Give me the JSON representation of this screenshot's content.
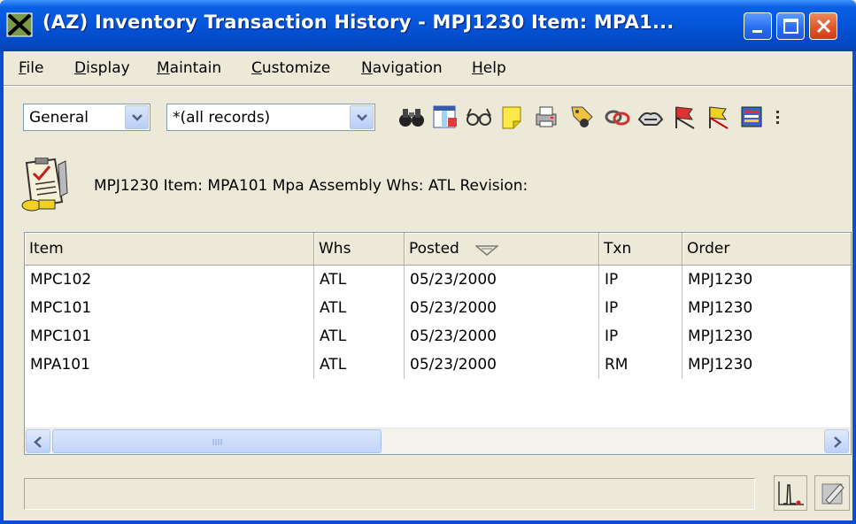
{
  "window": {
    "title": "(AZ) Inventory Transaction History - MPJ1230   Item: MPA1...",
    "app_icon": "job-x-icon",
    "controls": [
      "minimize-icon",
      "maximize-icon",
      "close-icon"
    ]
  },
  "menu": {
    "items": [
      {
        "label": "File"
      },
      {
        "label": "Display"
      },
      {
        "label": "Maintain"
      },
      {
        "label": "Customize"
      },
      {
        "label": "Navigation"
      },
      {
        "label": "Help"
      }
    ]
  },
  "toolbar": {
    "view_select": "General",
    "filter_select": "*(all records)",
    "tools": [
      "binoculars-icon",
      "column-chooser-icon",
      "glasses-icon",
      "note-icon",
      "printer-icon",
      "tag-icon",
      "link-icon",
      "handshake-icon",
      "flag-icon",
      "flag-alt-icon",
      "report-icon",
      "more-icon"
    ]
  },
  "header": {
    "icon": "clipboard-checklist-icon",
    "text": "MPJ1230  Item: MPA101  Mpa Assembly  Whs: ATL  Revision:"
  },
  "grid": {
    "columns": [
      {
        "label": "Item"
      },
      {
        "label": "Whs"
      },
      {
        "label": "Posted"
      },
      {
        "label": "Txn"
      },
      {
        "label": "Order"
      }
    ],
    "sort_icon": "sort-descending-icon",
    "rows": [
      {
        "item": "MPC102",
        "whs": "ATL",
        "posted": "05/23/2000",
        "txn": "IP",
        "order": "MPJ1230"
      },
      {
        "item": "MPC101",
        "whs": "ATL",
        "posted": "05/23/2000",
        "txn": "IP",
        "order": "MPJ1230"
      },
      {
        "item": "MPC101",
        "whs": "ATL",
        "posted": "05/23/2000",
        "txn": "IP",
        "order": "MPJ1230"
      },
      {
        "item": "MPA101",
        "whs": "ATL",
        "posted": "05/23/2000",
        "txn": "RM",
        "order": "MPJ1230"
      }
    ]
  },
  "statusbar": {
    "text": "",
    "buttons": [
      "chart-icon",
      "edit-icon"
    ]
  },
  "colors": {
    "titlebar": "#0454d8",
    "chrome": "#ece9d8",
    "grid_border": "#7f9db9"
  }
}
